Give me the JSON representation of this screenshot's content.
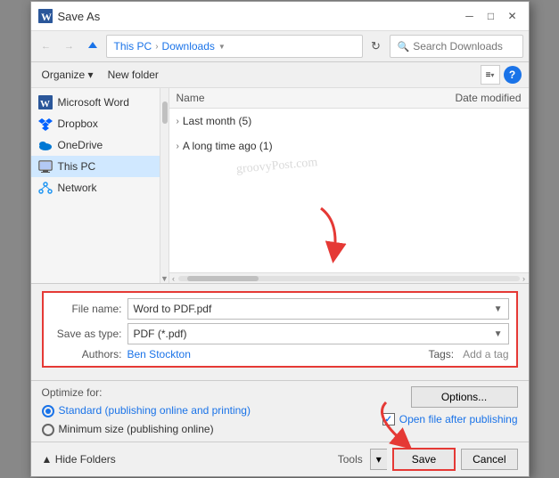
{
  "dialog": {
    "title": "Save As",
    "title_icon": "W"
  },
  "toolbar": {
    "back_label": "←",
    "forward_label": "→",
    "up_label": "↑",
    "breadcrumb": {
      "root": "This PC",
      "separator": ">",
      "current": "Downloads",
      "chevron": "▼"
    },
    "search_placeholder": "Search Downloads",
    "refresh_label": "↻"
  },
  "sub_toolbar": {
    "organize_label": "Organize ▾",
    "new_folder_label": "New folder",
    "view_icon": "≡",
    "help_label": "?"
  },
  "file_list": {
    "col_name": "Name",
    "col_date": "Date modified",
    "groups": [
      {
        "label": "Last month (5)",
        "count": 5
      },
      {
        "label": "A long time ago (1)",
        "count": 1
      }
    ]
  },
  "sidebar": {
    "items": [
      {
        "label": "Microsoft Word",
        "icon": "word"
      },
      {
        "label": "Dropbox",
        "icon": "dropbox"
      },
      {
        "label": "OneDrive",
        "icon": "onedrive"
      },
      {
        "label": "This PC",
        "icon": "thispc",
        "selected": true
      },
      {
        "label": "Network",
        "icon": "network"
      }
    ]
  },
  "form": {
    "filename_label": "File name:",
    "filename_value": "Word to PDF.pdf",
    "savetype_label": "Save as type:",
    "savetype_value": "PDF (*.pdf)",
    "authors_label": "Authors:",
    "authors_value": "Ben Stockton",
    "tags_label": "Tags:",
    "tags_value": "Add a tag"
  },
  "optimize": {
    "label": "Optimize for:",
    "options": [
      {
        "label": "Standard (publishing online and printing)",
        "selected": true
      },
      {
        "label": "Minimum size (publishing online)",
        "selected": false
      }
    ],
    "options_btn": "Options...",
    "open_after_label": "Open file after publishing",
    "open_after_checked": true
  },
  "bottom": {
    "hide_folders_label": "▲ Hide Folders",
    "tools_label": "Tools",
    "tools_dropdown": "▾",
    "save_label": "Save",
    "cancel_label": "Cancel"
  },
  "watermark": "groovyPost.com"
}
